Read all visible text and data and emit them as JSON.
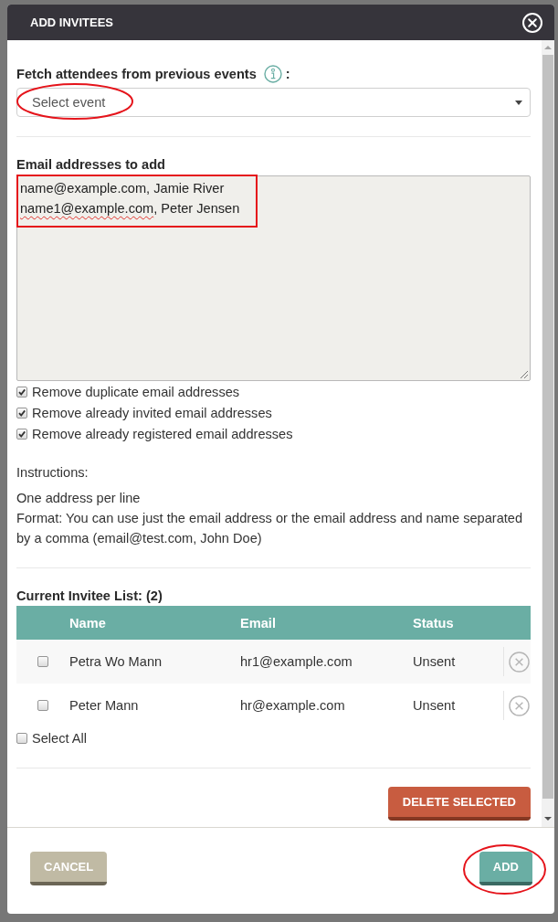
{
  "dialog": {
    "title": "ADD INVITEES"
  },
  "fetch": {
    "label": "Fetch attendees from previous events",
    "label_suffix": ":",
    "select": {
      "placeholder": "Select event",
      "highlighted": true
    }
  },
  "email_input": {
    "label": "Email addresses to add",
    "highlighted": true,
    "lines": [
      {
        "segments": [
          {
            "text": "name@example.com, Jamie River",
            "spell_flagged": false
          }
        ]
      },
      {
        "segments": [
          {
            "text": "name1@example.com",
            "spell_flagged": true
          },
          {
            "text": ", Peter Jensen",
            "spell_flagged": false
          }
        ]
      }
    ]
  },
  "options": [
    {
      "label": "Remove duplicate email addresses",
      "checked": true
    },
    {
      "label": "Remove already invited email addresses",
      "checked": true
    },
    {
      "label": "Remove already registered email addresses",
      "checked": true
    }
  ],
  "instructions": {
    "title": "Instructions:",
    "lines": [
      "One address per line",
      "Format: You can use just the email address or the email address and name separated by a comma (email@test.com, John Doe)"
    ]
  },
  "invitees": {
    "title": "Current Invitee List: (2)",
    "columns": [
      "Name",
      "Email",
      "Status"
    ],
    "rows": [
      {
        "name": "Petra Wo Mann",
        "email": "hr1@example.com",
        "status": "Unsent",
        "checked": false
      },
      {
        "name": "Peter Mann",
        "email": "hr@example.com",
        "status": "Unsent",
        "checked": false
      }
    ],
    "select_all": {
      "label": "Select All",
      "checked": false
    },
    "delete_button": {
      "label": "DELETE SELECTED"
    }
  },
  "footer": {
    "buttons": [
      {
        "label": "CANCEL",
        "kind": "secondary",
        "highlighted": false
      },
      {
        "label": "ADD",
        "kind": "primary",
        "highlighted": true
      }
    ]
  }
}
